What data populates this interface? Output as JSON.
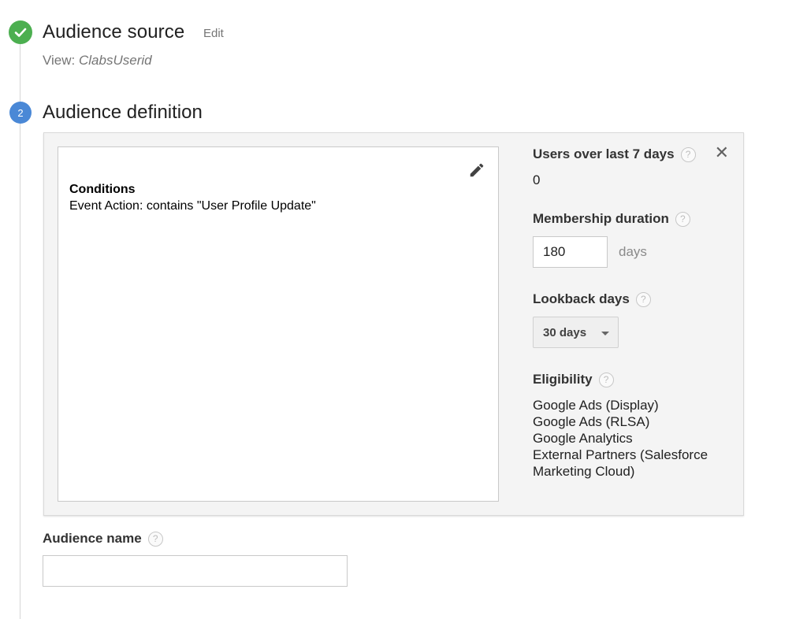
{
  "step1": {
    "title": "Audience source",
    "edit_label": "Edit",
    "view_prefix": "View: ",
    "view_value": "ClabsUserid"
  },
  "step2": {
    "number": "2",
    "title": "Audience definition"
  },
  "conditions": {
    "title": "Conditions",
    "text": "Event Action: contains \"User Profile Update\""
  },
  "side": {
    "users_label": "Users over last 7 days",
    "users_value": "0",
    "membership_label": "Membership duration",
    "membership_value": "180",
    "membership_unit": "days",
    "lookback_label": "Lookback days",
    "lookback_selected": "30 days",
    "eligibility_label": "Eligibility",
    "eligibility_items": [
      "Google Ads (Display)",
      "Google Ads (RLSA)",
      "Google Analytics",
      "External Partners (Salesforce Marketing Cloud)"
    ]
  },
  "audience_name": {
    "label": "Audience name",
    "value": ""
  },
  "help_glyph": "?",
  "close_glyph": "✕",
  "colors": {
    "success_green": "#4caf50",
    "step_blue": "#4a88d6",
    "panel_bg": "#f4f4f4"
  }
}
